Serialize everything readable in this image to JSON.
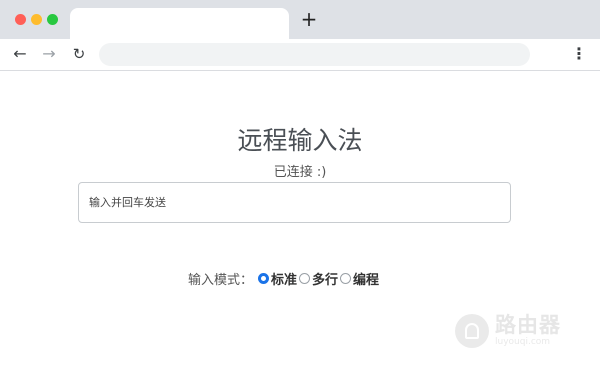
{
  "browser": {
    "new_tab_label": "+",
    "back_icon": "←",
    "forward_icon": "→",
    "reload_icon": "↻",
    "menu_icon": "⋮",
    "address_value": ""
  },
  "page": {
    "title": "远程输入法",
    "status": "已连接 :)",
    "input_placeholder": "输入并回车发送",
    "mode_label": "输入模式：",
    "modes": [
      {
        "label": "标准",
        "checked": true
      },
      {
        "label": "多行",
        "checked": false
      },
      {
        "label": "编程",
        "checked": false
      }
    ]
  },
  "watermark": {
    "main": "路由器",
    "sub": "luyouqi.com"
  },
  "colors": {
    "accent": "#1a73e8",
    "chrome": "#dee1e6"
  }
}
